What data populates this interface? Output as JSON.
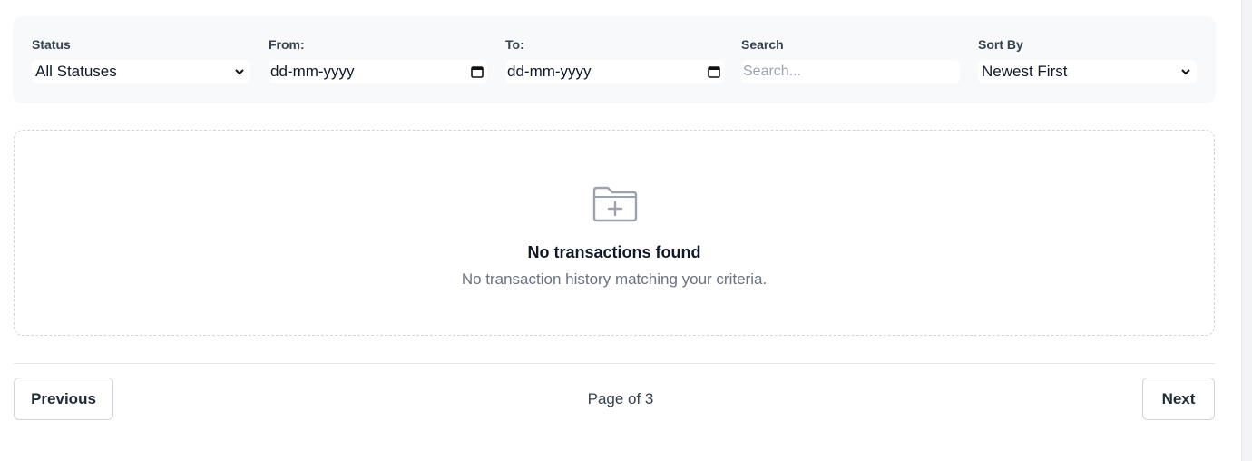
{
  "filters": {
    "status": {
      "label": "Status",
      "value": "All Statuses"
    },
    "from": {
      "label": "From:",
      "value": "dd-mm-yyyy"
    },
    "to": {
      "label": "To:",
      "value": "dd-mm-yyyy"
    },
    "search": {
      "label": "Search",
      "placeholder": "Search..."
    },
    "sort": {
      "label": "Sort By",
      "value": "Newest First"
    }
  },
  "empty_state": {
    "icon": "folder-plus-icon",
    "title": "No transactions found",
    "message": "No transaction history matching your criteria."
  },
  "pagination": {
    "previous_label": "Previous",
    "page_info": "Page of 3",
    "next_label": "Next"
  },
  "colors": {
    "panel_bg": "#f8f9fb",
    "border": "#d1d5db",
    "muted_text": "#6b7280"
  }
}
